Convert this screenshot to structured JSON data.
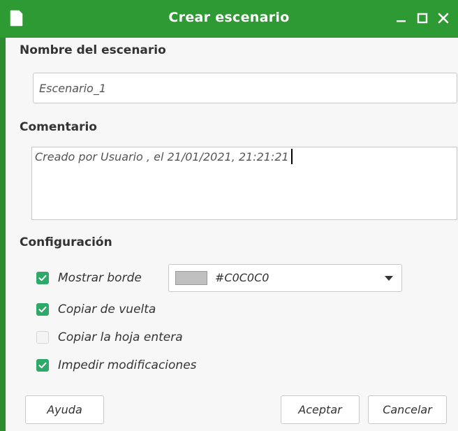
{
  "window": {
    "title": "Crear escenario",
    "accent_color": "#2e9a34"
  },
  "titlebar_icons": [
    "document-icon",
    "minimize-icon",
    "maximize-icon",
    "close-icon"
  ],
  "name_section": {
    "label": "Nombre del escenario",
    "value": "Escenario_1"
  },
  "comment_section": {
    "label": "Comentario",
    "value": "Creado por Usuario , el 21/01/2021, 21:21:21"
  },
  "config_section": {
    "label": "Configuración",
    "options": [
      {
        "label": "Mostrar borde",
        "checked": true
      },
      {
        "label": "Copiar de vuelta",
        "checked": true
      },
      {
        "label": "Copiar la hoja entera",
        "checked": false
      },
      {
        "label": "Impedir modificaciones",
        "checked": true
      }
    ],
    "border_color": {
      "selected_label": "#C0C0C0",
      "swatch_color": "#C0C0C0"
    }
  },
  "buttons": {
    "help": "Ayuda",
    "ok": "Aceptar",
    "cancel": "Cancelar"
  }
}
